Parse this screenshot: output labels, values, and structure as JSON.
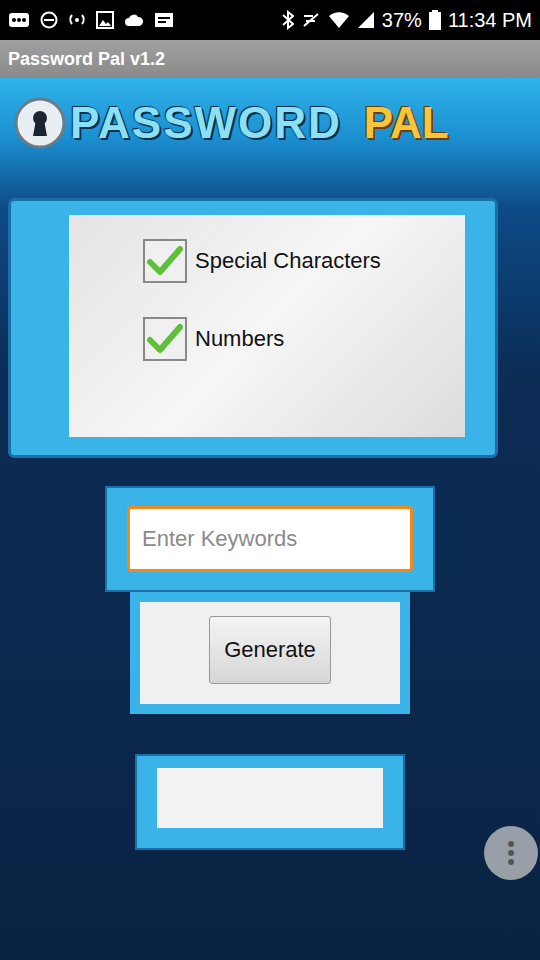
{
  "status_bar": {
    "battery": "37%",
    "time": "11:34 PM"
  },
  "window": {
    "title": "Password Pal v1.2"
  },
  "logo": {
    "word1": "PASSWORD",
    "word2": "PAL"
  },
  "options": [
    {
      "label": "Special Characters",
      "checked": true
    },
    {
      "label": "Numbers",
      "checked": true
    }
  ],
  "keywords": {
    "placeholder": "Enter Keywords",
    "focused": true
  },
  "buttons": [
    "Generate"
  ]
}
